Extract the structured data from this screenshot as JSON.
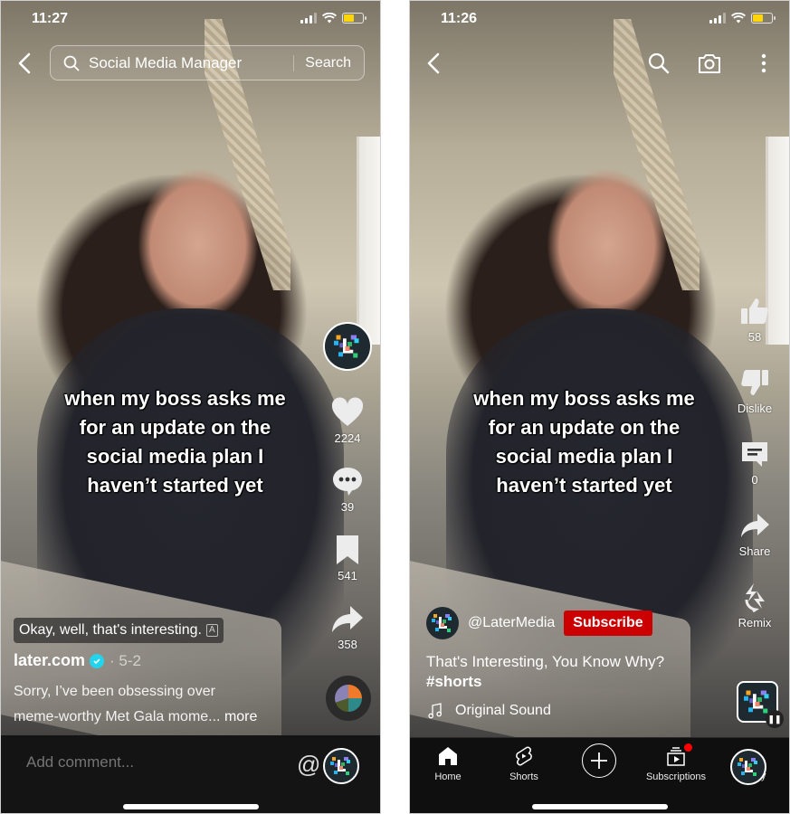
{
  "left": {
    "app": "TikTok",
    "status_bar": {
      "time": "11:27",
      "battery_color": "#ffd60a"
    },
    "search": {
      "query": "Social Media Manager",
      "button_label": "Search"
    },
    "overlay_caption": [
      "when my boss asks me",
      "for an update on the",
      "social media plan I",
      "haven’t started yet"
    ],
    "rail": {
      "likes": "2224",
      "comments": "39",
      "saves": "541",
      "shares": "358"
    },
    "subtitle_chip": "Okay, well, that's interesting.",
    "subtitle_chip_icon": "A",
    "author": "later.com",
    "date": "· 5-2",
    "description_line1": "Sorry, I’ve been obsessing over",
    "description_line2": "meme-worthy Met Gala mome...",
    "more_label": "more",
    "comment_placeholder": "Add comment...",
    "at_symbol": "@",
    "colors": {
      "verified": "#20d5ec",
      "bar_bg": "#141414"
    }
  },
  "right": {
    "app": "YouTube Shorts",
    "status_bar": {
      "time": "11:26",
      "battery_color": "#ffd60a"
    },
    "overlay_caption": [
      "when my boss asks me",
      "for an update on the",
      "social media plan I",
      "haven’t started yet"
    ],
    "rail": {
      "likes": "58",
      "dislike_label": "Dislike",
      "comments": "0",
      "share_label": "Share",
      "remix_label": "Remix"
    },
    "channel": "@LaterMedia",
    "subscribe_label": "Subscribe",
    "title": "That's Interesting, You Know Why?",
    "hashtag": "#shorts",
    "sound": "Original Sound",
    "nav": {
      "home": "Home",
      "shorts": "Shorts",
      "subscriptions": "Subscriptions",
      "you": "y"
    },
    "colors": {
      "subscribe": "#cc0000",
      "notification_dot": "#ff0000",
      "nav_bg": "#0f0f0f"
    }
  }
}
